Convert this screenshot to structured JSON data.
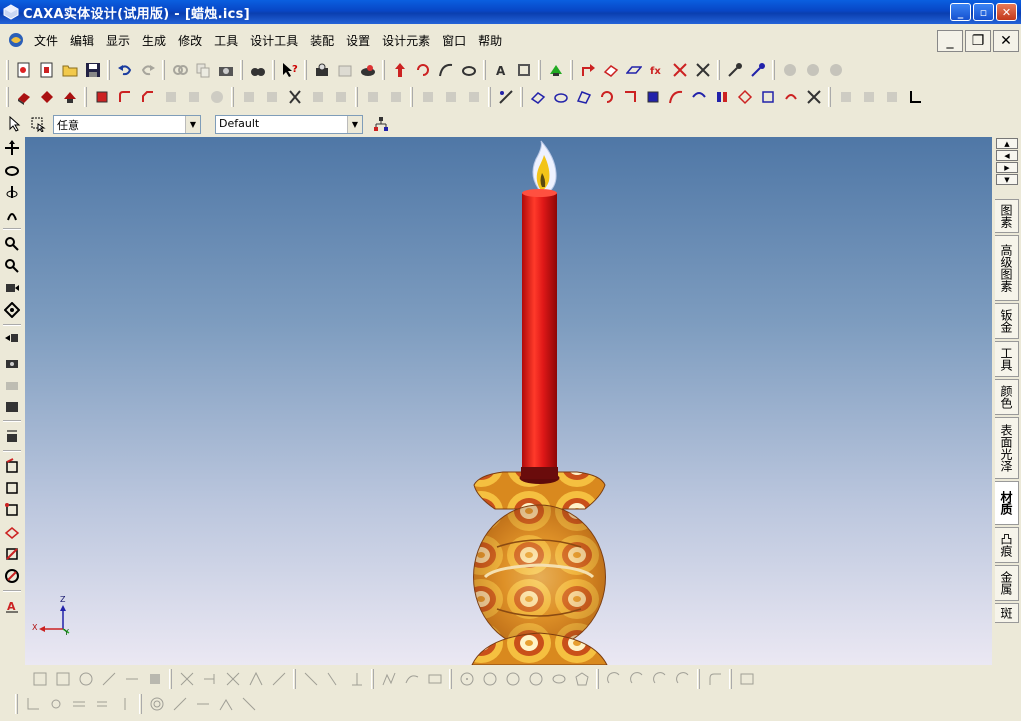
{
  "window": {
    "title": "CAXA实体设计(试用版) - [蜡烛.ics]",
    "minimize": "_",
    "maximize": "▫",
    "close": "✕"
  },
  "menu": {
    "items": [
      "文件",
      "编辑",
      "显示",
      "生成",
      "修改",
      "工具",
      "设计工具",
      "装配",
      "设置",
      "设计元素",
      "窗口",
      "帮助"
    ],
    "mdi_minimize": "_",
    "mdi_restore": "❐",
    "mdi_close": "✕"
  },
  "selection": {
    "filter_value": "任意",
    "style_value": "Default"
  },
  "design_elements_tabs": [
    "图素",
    "高级图素",
    "钣金",
    "工具",
    "颜色",
    "表面光泽",
    "材质",
    "凸痕",
    "金属",
    "斑"
  ],
  "active_tab": "材质",
  "axes": {
    "z": "Z",
    "x": "X",
    "y": "Y"
  },
  "colors": {
    "title_blue": "#0846c5",
    "candle_red": "#e01818",
    "flame_yellow": "#f2c418"
  }
}
